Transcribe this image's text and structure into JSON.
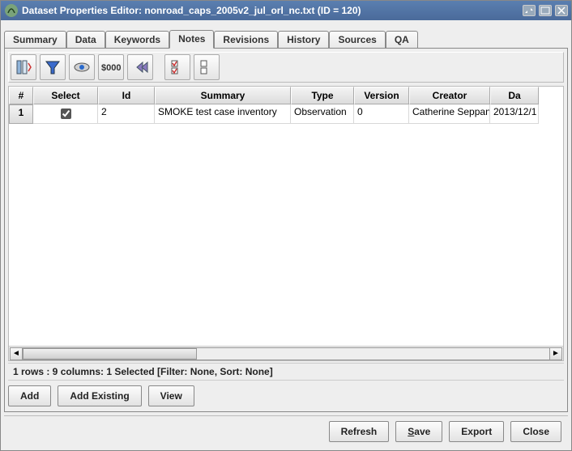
{
  "window": {
    "title": "Dataset Properties Editor: nonroad_caps_2005v2_jul_orl_nc.txt (ID = 120)"
  },
  "tabs": {
    "items": [
      {
        "label": "Summary"
      },
      {
        "label": "Data"
      },
      {
        "label": "Keywords"
      },
      {
        "label": "Notes"
      },
      {
        "label": "Revisions"
      },
      {
        "label": "History"
      },
      {
        "label": "Sources"
      },
      {
        "label": "QA"
      }
    ],
    "active_index": 3
  },
  "toolbar": {
    "icons": [
      "columns-icon",
      "filter-icon",
      "eye-icon",
      "currency-format-icon",
      "first-page-icon",
      "checklist-icon",
      "uncheck-icon"
    ]
  },
  "table": {
    "columns": [
      "#",
      "Select",
      "Id",
      "Summary",
      "Type",
      "Version",
      "Creator",
      "Da"
    ],
    "rows": [
      {
        "idx": "1",
        "select": true,
        "id": "2",
        "summary": "SMOKE test case inventory",
        "type": "Observation",
        "version": "0",
        "creator": "Catherine Seppanen",
        "date": "2013/12/1"
      }
    ]
  },
  "status": "1 rows : 9 columns: 1 Selected [Filter: None, Sort: None]",
  "actions": {
    "add": "Add",
    "add_existing": "Add Existing",
    "view": "View"
  },
  "footer": {
    "refresh": "Refresh",
    "save_pre": "S",
    "save_rest": "ave",
    "export": "Export",
    "close": "Close"
  }
}
